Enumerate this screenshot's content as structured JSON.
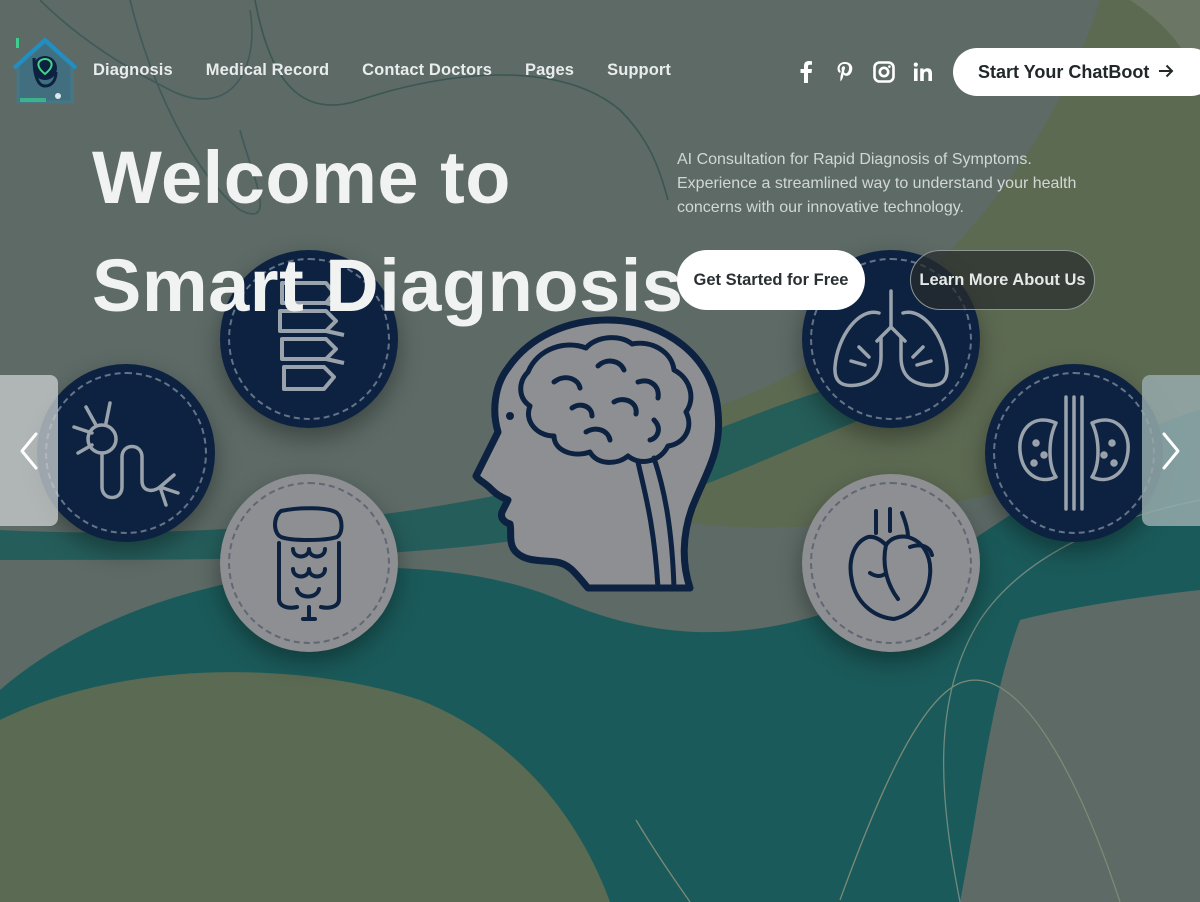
{
  "header": {
    "logo_icon": "medical-house-logo",
    "nav": [
      {
        "label": "Diagnosis"
      },
      {
        "label": "Medical Record"
      },
      {
        "label": "Contact Doctors"
      },
      {
        "label": "Pages"
      },
      {
        "label": "Support"
      }
    ],
    "socials": [
      "facebook-icon",
      "pinterest-icon",
      "instagram-icon",
      "linkedin-icon"
    ],
    "cta_label": "Start Your ChatBoot",
    "cta_icon": "arrow-right-icon"
  },
  "hero": {
    "title_line1": "Welcome to",
    "title_line2": "Smart Diagnosis",
    "description": "AI Consultation for Rapid Diagnosis of Symptoms. Experience a streamlined way to understand your health concerns with our innovative technology.",
    "primary_button": "Get Started for Free",
    "secondary_button": "Learn More About Us"
  },
  "carousel": {
    "center_icon": "human-head-brain-icon",
    "organs": [
      "spine-icon",
      "lungs-icon",
      "neuron-icon",
      "kidneys-icon",
      "intestines-icon",
      "heart-icon"
    ],
    "prev_icon": "chevron-left-icon",
    "next_icon": "chevron-right-icon"
  },
  "colors": {
    "background": "#5d6a66",
    "teal": "#1b5a5a",
    "olive": "#5b6a52",
    "navy": "#0c2240",
    "button_bg": "#ffffff"
  }
}
